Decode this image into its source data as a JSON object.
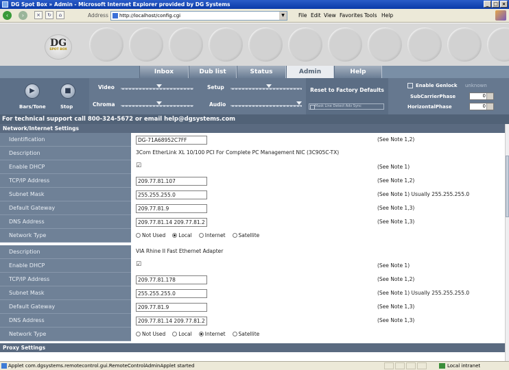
{
  "window": {
    "title": "DG Spot Box » Admin - Microsoft Internet Explorer provided by DG Systems"
  },
  "toolbar": {
    "address_label": "Address",
    "url": "http://localhost/config.cgi",
    "menus": [
      "File",
      "Edit",
      "View",
      "Favorites",
      "Tools",
      "Help"
    ]
  },
  "logo": {
    "mark": "DG",
    "sub": "SPOT BOX"
  },
  "tabs": [
    {
      "label": "Inbox",
      "active": false
    },
    {
      "label": "Dub list",
      "active": false
    },
    {
      "label": "Status",
      "active": false
    },
    {
      "label": "Admin",
      "active": true
    },
    {
      "label": "Help",
      "active": false
    }
  ],
  "controls": {
    "bars_tone_label": "Bars/Tone",
    "stop_label": "Stop",
    "video_label": "Video",
    "chroma_label": "Chroma",
    "setup_label": "Setup",
    "audio_label": "Audio",
    "reset_label": "Reset to Factory Defaults",
    "mini_option": "Mask Line Detect  Adv Sync",
    "genlock_label": "Enable Genlock",
    "genlock_status": "unknown",
    "subcarrier_label": "SubCarrierPhase",
    "subcarrier_value": "0",
    "horizontal_label": "HorizontalPhase",
    "horizontal_value": "0"
  },
  "support_text": "For technical support call 800-324-5672 or email help@dgsystems.com",
  "network": {
    "section_title": "Network/Internet Settings",
    "identification_label": "Identification",
    "identification_value": "DG-71A68952C7FF",
    "identification_note": "(See Note 1,2)",
    "adapters": [
      {
        "description_label": "Description",
        "description": "3Com EtherLink XL 10/100 PCI For Complete PC Management NIC (3C905C-TX)",
        "dhcp_label": "Enable DHCP",
        "dhcp_checked": true,
        "dhcp_note": "(See Note 1)",
        "ip_label": "TCP/IP Address",
        "ip": "209.77.81.107",
        "ip_note": "(See Note 1,2)",
        "mask_label": "Subnet Mask",
        "mask": "255.255.255.0",
        "mask_note": "(See Note 1) Usually 255.255.255.0",
        "gateway_label": "Default Gateway",
        "gateway": "209.77.81.9",
        "gateway_note": "(See Note 1,3)",
        "dns_label": "DNS Address",
        "dns": "209.77.81.14 209.77.81.2",
        "dns_note": "(See Note 1,3)",
        "type_label": "Network Type",
        "type_options": [
          "Not Used",
          "Local",
          "Internet",
          "Satellite"
        ],
        "type_selected": "Local"
      },
      {
        "description_label": "Description",
        "description": "VIA Rhine II Fast Ethernet Adapter",
        "dhcp_label": "Enable DHCP",
        "dhcp_checked": true,
        "dhcp_note": "(See Note 1)",
        "ip_label": "TCP/IP Address",
        "ip": "209.77.81.178",
        "ip_note": "(See Note 1,2)",
        "mask_label": "Subnet Mask",
        "mask": "255.255.255.0",
        "mask_note": "(See Note 1) Usually 255.255.255.0",
        "gateway_label": "Default Gateway",
        "gateway": "209.77.81.9",
        "gateway_note": "(See Note 1,3)",
        "dns_label": "DNS Address",
        "dns": "209.77.81.14 209.77.81.2",
        "dns_note": "(See Note 1,3)",
        "type_label": "Network Type",
        "type_options": [
          "Not Used",
          "Local",
          "Internet",
          "Satellite"
        ],
        "type_selected": "Internet"
      }
    ],
    "proxy_title": "Proxy Settings"
  },
  "status": {
    "text": "Applet com.dgsystems.remotecontrol.gui.RemoteControlAdminApplet started",
    "zone": "Local intranet"
  },
  "colors": {
    "label_bg": "#6f8197",
    "section_bg": "#5a6a80",
    "panel_bg": "#66788f",
    "tab_active_bg": "#e9ecf0"
  }
}
